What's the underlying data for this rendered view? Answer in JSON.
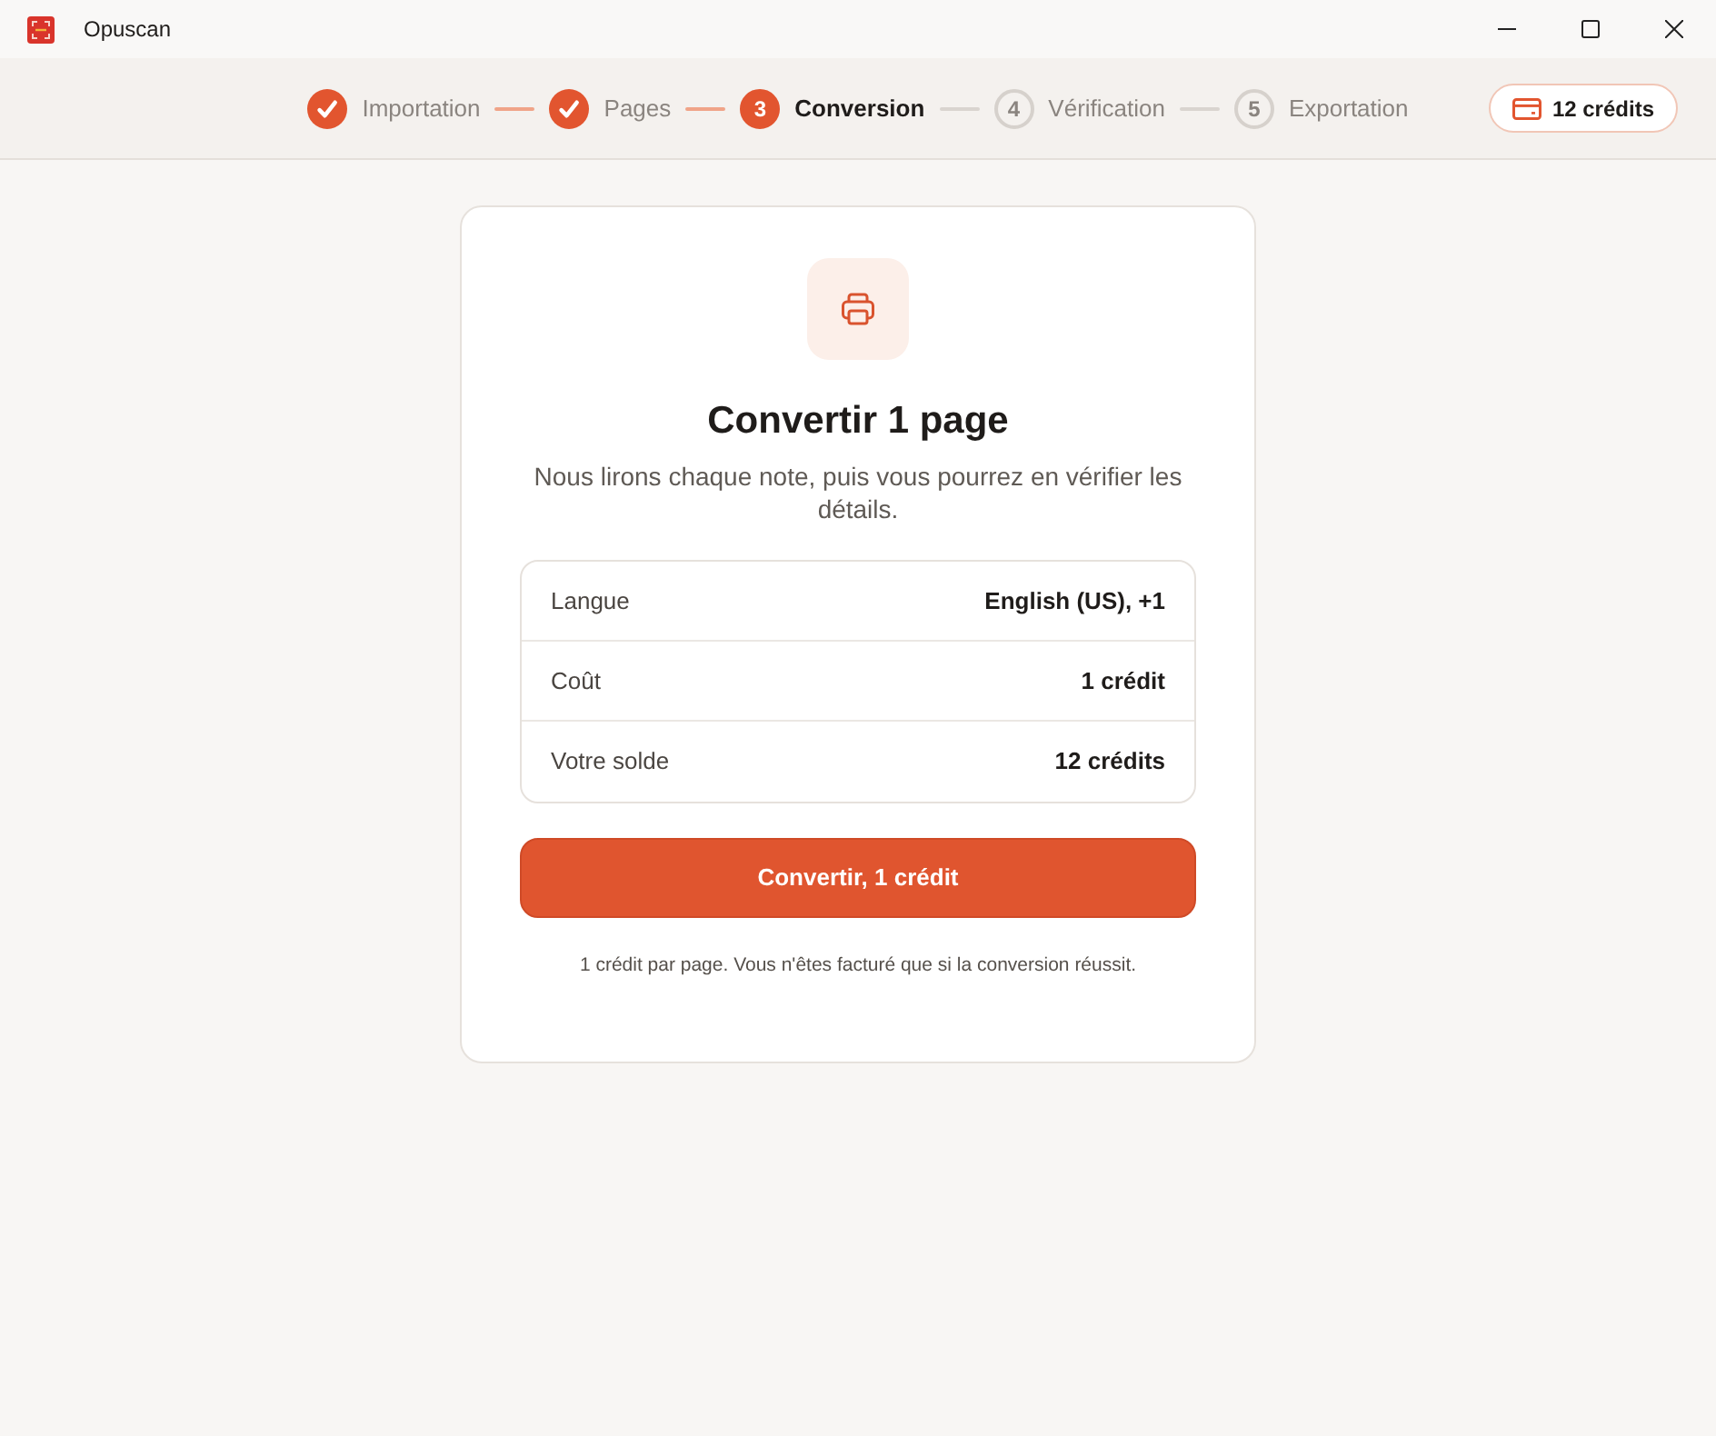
{
  "window": {
    "title": "Opuscan"
  },
  "stepper": {
    "steps": [
      {
        "label": "Importation",
        "completed": true,
        "selected": false
      },
      {
        "label": "Pages",
        "completed": true,
        "selected": false
      },
      {
        "number": "3",
        "label": "Conversion",
        "completed": false,
        "selected": true
      },
      {
        "number": "4",
        "label": "Vérification",
        "completed": false,
        "selected": false
      },
      {
        "number": "5",
        "label": "Exportation",
        "completed": false,
        "selected": false
      }
    ]
  },
  "credits_badge": {
    "label": "12 crédits"
  },
  "card": {
    "title": "Convertir 1 page",
    "description": "Nous lirons chaque note, puis vous pourrez en vérifier les détails.",
    "details": [
      {
        "label": "Langue",
        "value": "English (US), +1"
      },
      {
        "label": "Coût",
        "value": "1 crédit"
      },
      {
        "label": "Votre solde",
        "value": "12 crédits"
      }
    ],
    "primary_button": "Convertir, 1 crédit",
    "note": "1 crédit par page. Vous n'êtes facturé que si la conversion réussit."
  }
}
